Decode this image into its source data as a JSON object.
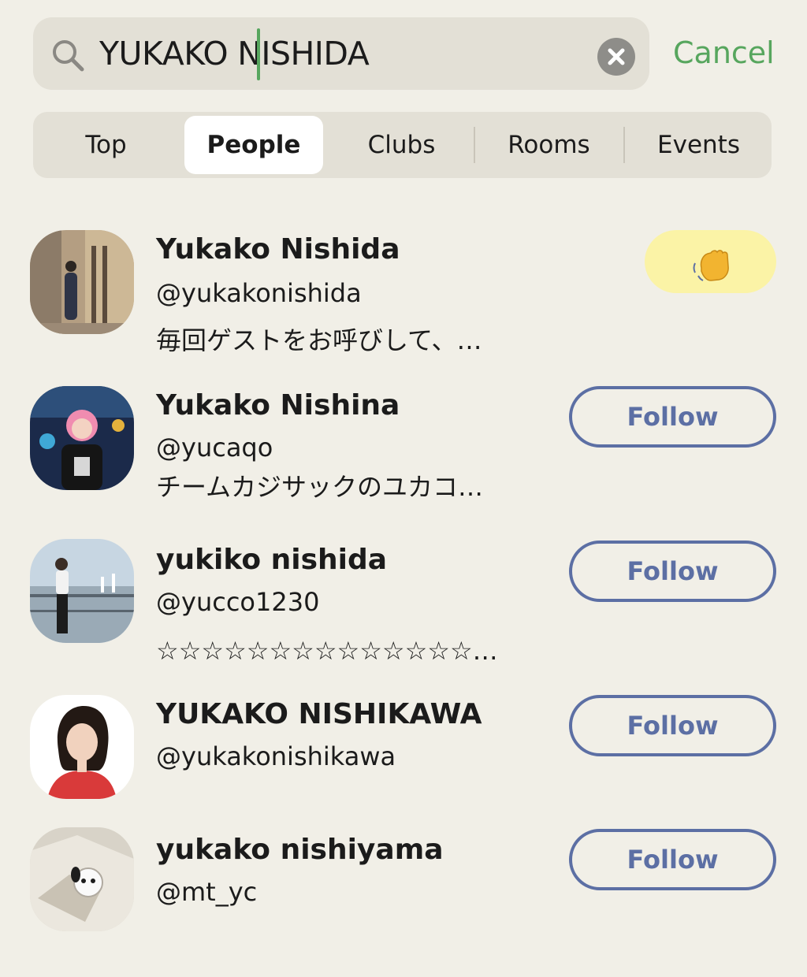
{
  "search": {
    "query_part1": "YUKAKO",
    "query_part2": "NISHIDA",
    "clear_icon": "close-circle-icon",
    "cancel_label": "Cancel",
    "accent": "#57a65e"
  },
  "tabs": [
    {
      "label": "Top",
      "active": false
    },
    {
      "label": "People",
      "active": true
    },
    {
      "label": "Clubs",
      "active": false
    },
    {
      "label": "Rooms",
      "active": false
    },
    {
      "label": "Events",
      "active": false
    }
  ],
  "results": [
    {
      "name": "Yukako Nishida",
      "handle": "@yukakonishida",
      "bio": "毎回ゲストをお呼びして、…",
      "action": "wave",
      "action_icon": "waving-hand-icon"
    },
    {
      "name": "Yukako Nishina",
      "handle": "@yucaqo",
      "bio": "チームカジサックのユカコ…",
      "action": "Follow"
    },
    {
      "name": "yukiko nishida",
      "handle": "@yucco1230",
      "bio": "☆☆☆☆☆☆☆☆☆☆☆☆☆☆…",
      "action": "Follow"
    },
    {
      "name": "YUKAKO NISHIKAWA",
      "handle": "@yukakonishikawa",
      "bio": "",
      "action": "Follow"
    },
    {
      "name": "yukako nishiyama",
      "handle": "@mt_yc",
      "bio": "",
      "action": "Follow"
    }
  ],
  "colors": {
    "background": "#f1efe7",
    "follow_outline": "#5c6fa4",
    "wave_bg": "#fbf3a6"
  }
}
